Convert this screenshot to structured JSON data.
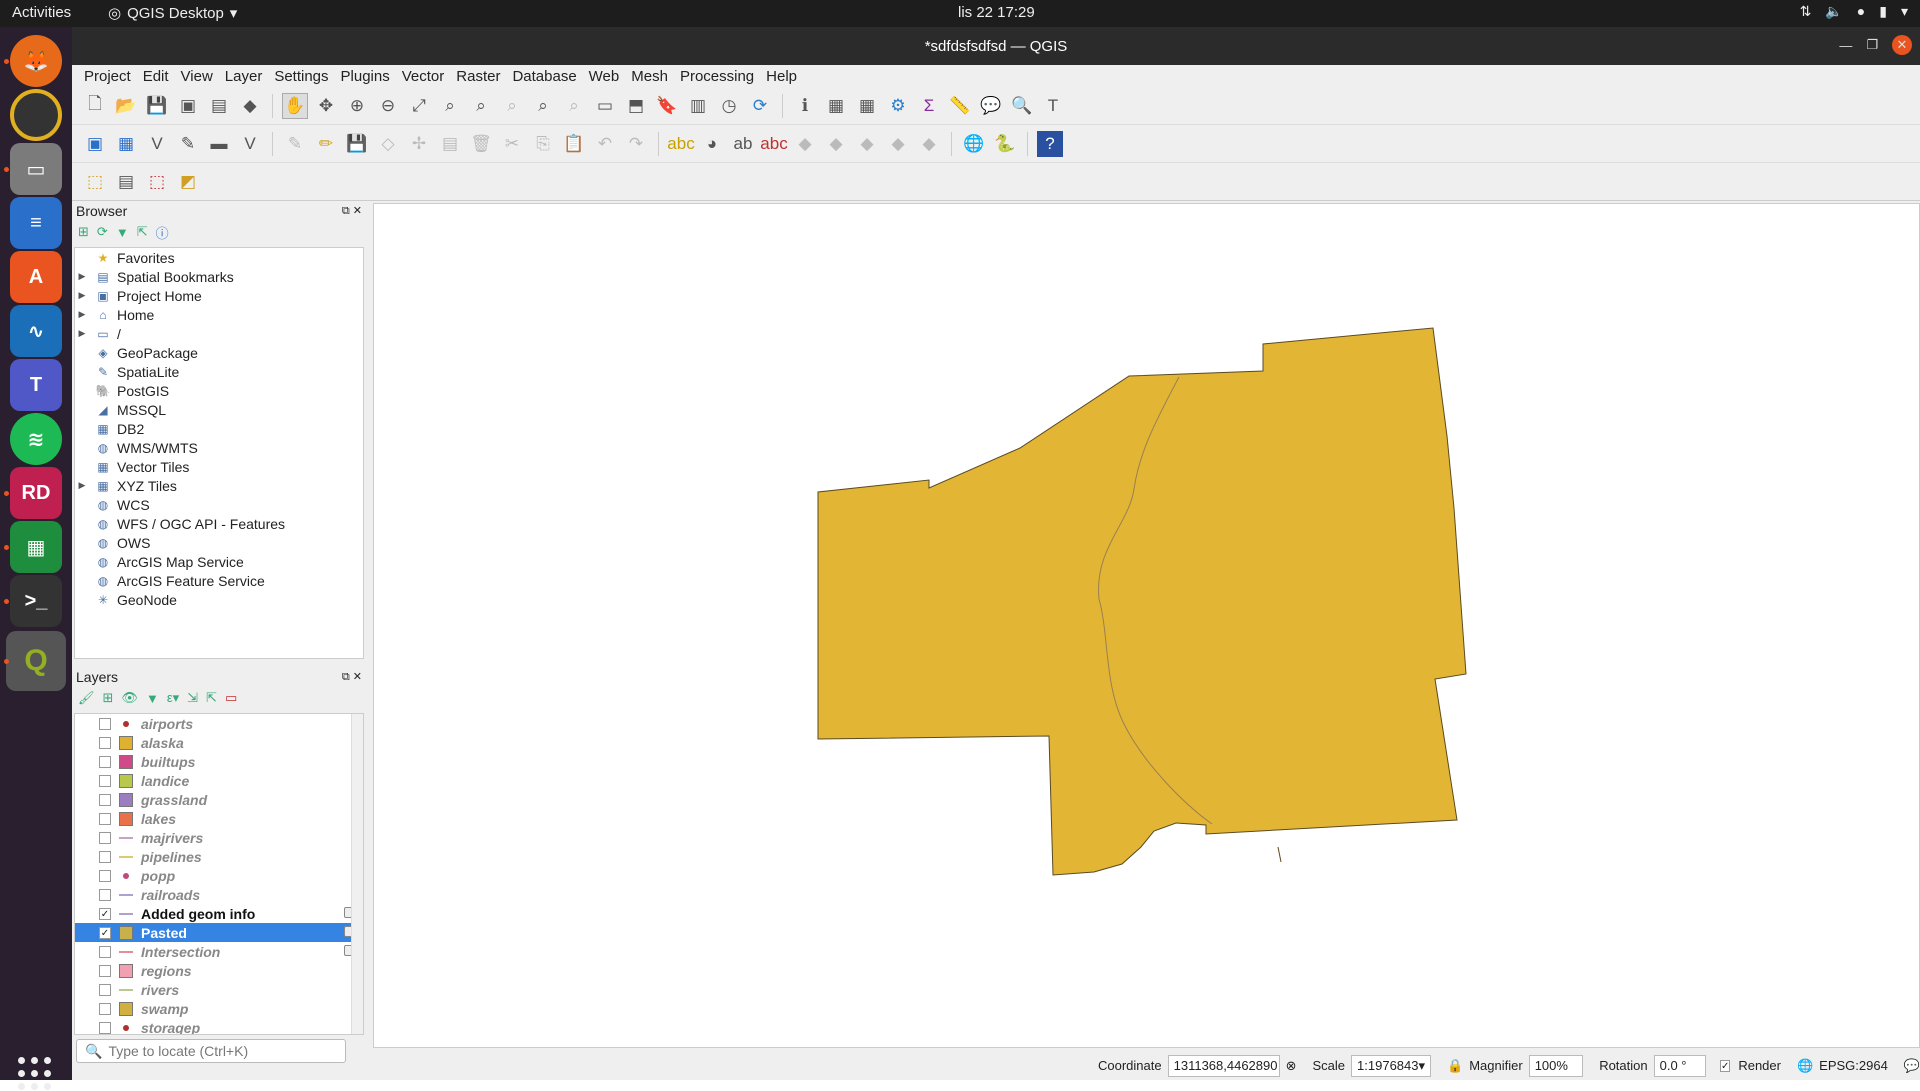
{
  "topbar": {
    "activities": "Activities",
    "app_name": "QGIS Desktop",
    "clock": "lis 22  17:29"
  },
  "window": {
    "title": "*sdfdsfsdfsd — QGIS"
  },
  "menu": [
    "Project",
    "Edit",
    "View",
    "Layer",
    "Settings",
    "Plugins",
    "Vector",
    "Raster",
    "Database",
    "Web",
    "Mesh",
    "Processing",
    "Help"
  ],
  "browser": {
    "title": "Browser",
    "items": [
      {
        "label": "Favorites",
        "icon": "star-icon",
        "arrow": false
      },
      {
        "label": "Spatial Bookmarks",
        "icon": "bookmark-icon",
        "arrow": true
      },
      {
        "label": "Project Home",
        "icon": "project-home-icon",
        "arrow": true
      },
      {
        "label": "Home",
        "icon": "home-icon",
        "arrow": true
      },
      {
        "label": "/",
        "icon": "folder-icon",
        "arrow": true
      },
      {
        "label": "GeoPackage",
        "icon": "geopackage-icon",
        "arrow": false
      },
      {
        "label": "SpatiaLite",
        "icon": "spatialite-icon",
        "arrow": false
      },
      {
        "label": "PostGIS",
        "icon": "postgis-icon",
        "arrow": false
      },
      {
        "label": "MSSQL",
        "icon": "mssql-icon",
        "arrow": false
      },
      {
        "label": "DB2",
        "icon": "db2-icon",
        "arrow": false
      },
      {
        "label": "WMS/WMTS",
        "icon": "globe-icon",
        "arrow": false
      },
      {
        "label": "Vector Tiles",
        "icon": "grid-icon",
        "arrow": false
      },
      {
        "label": "XYZ Tiles",
        "icon": "grid-icon",
        "arrow": true
      },
      {
        "label": "WCS",
        "icon": "globe-icon",
        "arrow": false
      },
      {
        "label": "WFS / OGC API - Features",
        "icon": "globe-icon",
        "arrow": false
      },
      {
        "label": "OWS",
        "icon": "globe-icon",
        "arrow": false
      },
      {
        "label": "ArcGIS Map Service",
        "icon": "globe-icon",
        "arrow": false
      },
      {
        "label": "ArcGIS Feature Service",
        "icon": "globe-icon",
        "arrow": false
      },
      {
        "label": "GeoNode",
        "icon": "geonode-icon",
        "arrow": false
      }
    ]
  },
  "layers": {
    "title": "Layers",
    "items": [
      {
        "name": "airports",
        "kind": "dot",
        "color": "#b03030",
        "checked": false
      },
      {
        "name": "alaska",
        "kind": "fill",
        "color": "#e0b030",
        "checked": false
      },
      {
        "name": "builtups",
        "kind": "fill",
        "color": "#d04a8a",
        "checked": false
      },
      {
        "name": "landice",
        "kind": "fill",
        "color": "#b8c84a",
        "checked": false
      },
      {
        "name": "grassland",
        "kind": "fill",
        "color": "#9a7ec0",
        "checked": false
      },
      {
        "name": "lakes",
        "kind": "fill",
        "color": "#e8704a",
        "checked": false
      },
      {
        "name": "majrivers",
        "kind": "line",
        "color": "#c8a0c8",
        "checked": false
      },
      {
        "name": "pipelines",
        "kind": "line",
        "color": "#e0c870",
        "checked": false
      },
      {
        "name": "popp",
        "kind": "dot",
        "color": "#c04a7a",
        "checked": false
      },
      {
        "name": "railroads",
        "kind": "line",
        "color": "#b0a0d0",
        "checked": false
      },
      {
        "name": "Added geom info",
        "kind": "line",
        "color": "#b0a0d0",
        "checked": true
      },
      {
        "name": "Pasted",
        "kind": "fill",
        "color": "#c8b04a",
        "checked": true
      },
      {
        "name": "Intersection",
        "kind": "line",
        "color": "#e09090",
        "checked": false
      },
      {
        "name": "regions",
        "kind": "fill",
        "color": "#f0a0b0",
        "checked": false
      },
      {
        "name": "rivers",
        "kind": "line",
        "color": "#b8c890",
        "checked": false
      },
      {
        "name": "swamp",
        "kind": "fill",
        "color": "#d0b040",
        "checked": false
      },
      {
        "name": "storagep",
        "kind": "dot",
        "color": "#b03030",
        "checked": false
      }
    ]
  },
  "locate": {
    "placeholder": "Type to locate (Ctrl+K)"
  },
  "map": {
    "fill": "#e3b535",
    "stroke": "#5a4a20",
    "river": "#9a8050"
  },
  "status": {
    "coordinate_label": "Coordinate",
    "coordinate": "1311368,4462890",
    "scale_label": "Scale",
    "scale": "1:1976843",
    "magnifier_label": "Magnifier",
    "magnifier": "100%",
    "rotation_label": "Rotation",
    "rotation": "0.0 °",
    "render_label": "Render",
    "crs": "EPSG:2964"
  }
}
